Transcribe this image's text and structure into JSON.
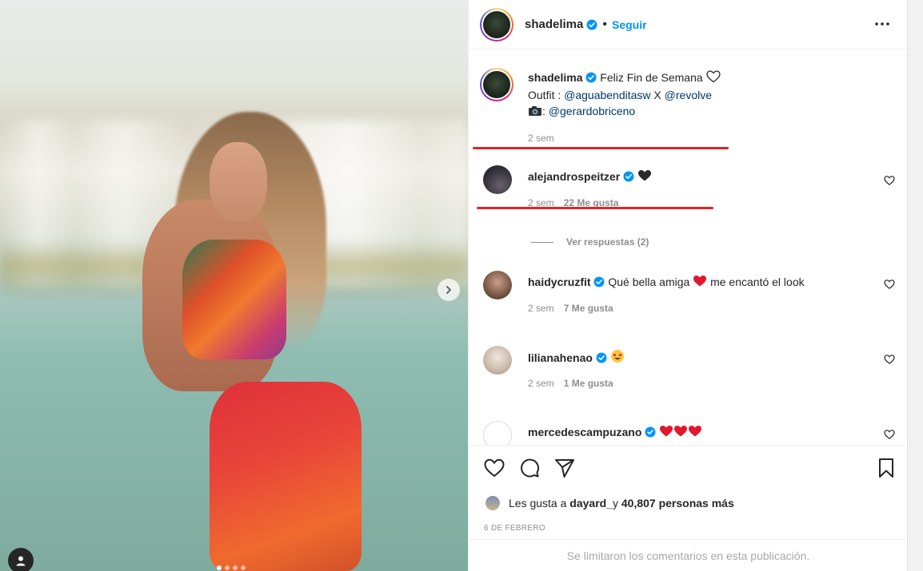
{
  "post_author": {
    "username": "shadelima",
    "separator": "•",
    "follow_label": "Seguir"
  },
  "caption": {
    "username": "shadelima",
    "text": "Feliz Fin de Semana",
    "outfit_prefix": "Outfit : ",
    "outfit_link1": "@aguabenditasw",
    "outfit_join": " X ",
    "outfit_link2": "@revolve",
    "photo_prefix": ": ",
    "photo_link": "@gerardobriceno",
    "time": "2 sem"
  },
  "comments": [
    {
      "username": "alejandrospeitzer",
      "text": "",
      "emojis": [
        "black-heart"
      ],
      "time": "2 sem",
      "likes": "22 Me gusta"
    },
    {
      "username": "haidycruzfit",
      "text_before": "Qué bella amiga",
      "text_after": "me encantó el look",
      "emojis": [
        "red-heart"
      ],
      "time": "2 sem",
      "likes": "7 Me gusta"
    },
    {
      "username": "lilianahenao",
      "text": "",
      "emojis": [
        "star-struck"
      ],
      "time": "2 sem",
      "likes": "1 Me gusta"
    },
    {
      "username": "mercedescampuzano",
      "text": "",
      "emojis": [
        "red-heart",
        "red-heart",
        "red-heart"
      ]
    }
  ],
  "view_replies_label": "Ver respuestas (2)",
  "likes_summary": {
    "prefix": "Les gusta a ",
    "user": "dayard_",
    "middle": " y ",
    "count": "40,807 personas más"
  },
  "post_date": "6 DE FEBRERO",
  "comments_limited_text": "Se limitaron los comentarios en esta publicación.",
  "carousel": {
    "current": 1,
    "total": 4
  },
  "colors": {
    "accent_blue": "#0095f6",
    "annotation_red": "#e0242a"
  }
}
